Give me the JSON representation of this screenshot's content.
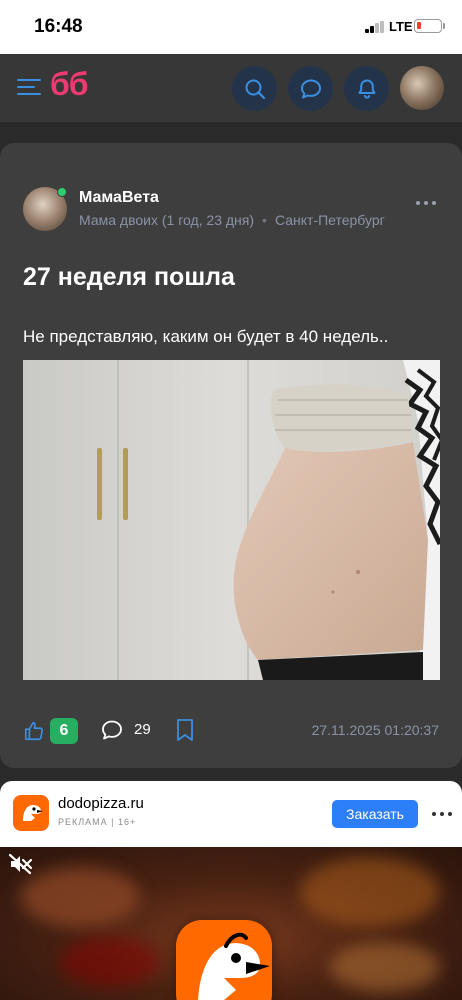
{
  "status_bar": {
    "time": "16:48",
    "network": "LTE"
  },
  "header": {
    "logo": "бб"
  },
  "post": {
    "author": {
      "name": "МамаВета",
      "subtitle": "Мама двоих (1 год, 23 дня)",
      "city": "Санкт-Петербург"
    },
    "title": "27 неделя пошла",
    "text": "Не представляю, каким он будет в 40 недель..",
    "likes": "6",
    "comments": "29",
    "date": "27.11.2025 01:20:37"
  },
  "ad": {
    "domain": "dodopizza.ru",
    "label": "РЕКЛАМА",
    "age": "16+",
    "button": "Заказать"
  },
  "colors": {
    "accent_blue": "#3a8fe0",
    "logo_pink": "#ee3a73",
    "like_green": "#27ae60",
    "ad_button": "#2d7ff9",
    "dodo_orange": "#ff6900"
  }
}
